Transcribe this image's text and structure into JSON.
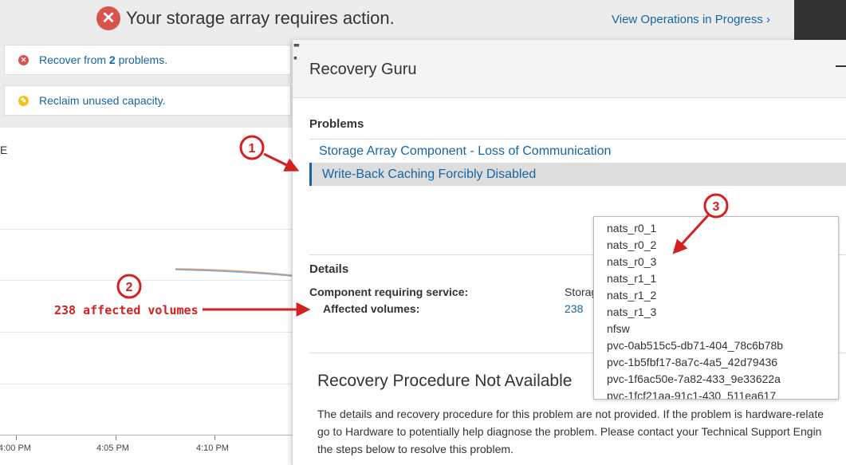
{
  "banner": {
    "title": "Your storage array requires action.",
    "ops_link": "View Operations in Progress ›"
  },
  "alerts": [
    {
      "prefix": "Recover from ",
      "count": "2",
      "suffix": " problems."
    },
    {
      "text": "Reclaim unused capacity."
    }
  ],
  "chart": {
    "partial_label": "E",
    "x_ticks": [
      "4:00 PM",
      "4:05 PM",
      "4:10 PM"
    ]
  },
  "modal": {
    "title": "Recovery Guru",
    "problems_heading": "Problems",
    "problems": [
      "Storage Array Component - Loss of Communication",
      "Write-Back Caching Forcibly Disabled"
    ],
    "details_heading": "Details",
    "component_label": "Component requiring service:",
    "component_value": "Storag",
    "affected_label": "Affected volumes:",
    "affected_value": "238",
    "procedure_title": "Recovery Procedure Not Available",
    "procedure_lines": [
      "The details and recovery procedure for this problem are not provided. If the problem is hardware-relate",
      "go to Hardware to potentially help diagnose the problem. Please contact your Technical Support Engin",
      "the steps below to resolve this problem."
    ]
  },
  "volumes_popup": [
    "nats_r0_1",
    "nats_r0_2",
    "nats_r0_3",
    "nats_r1_1",
    "nats_r1_2",
    "nats_r1_3",
    "nfsw",
    "pvc-0ab515c5-db71-404_78c6b78b",
    "pvc-1b5fbf17-8a7c-4a5_42d79436",
    "pvc-1f6ac50e-7a82-433_9e33622a",
    "pvc-1fcf21aa-91c1-430_511ea617"
  ],
  "annotations": {
    "markers": [
      "1",
      "2",
      "3"
    ],
    "note": "238 affected volumes",
    "color": "#d42020"
  }
}
